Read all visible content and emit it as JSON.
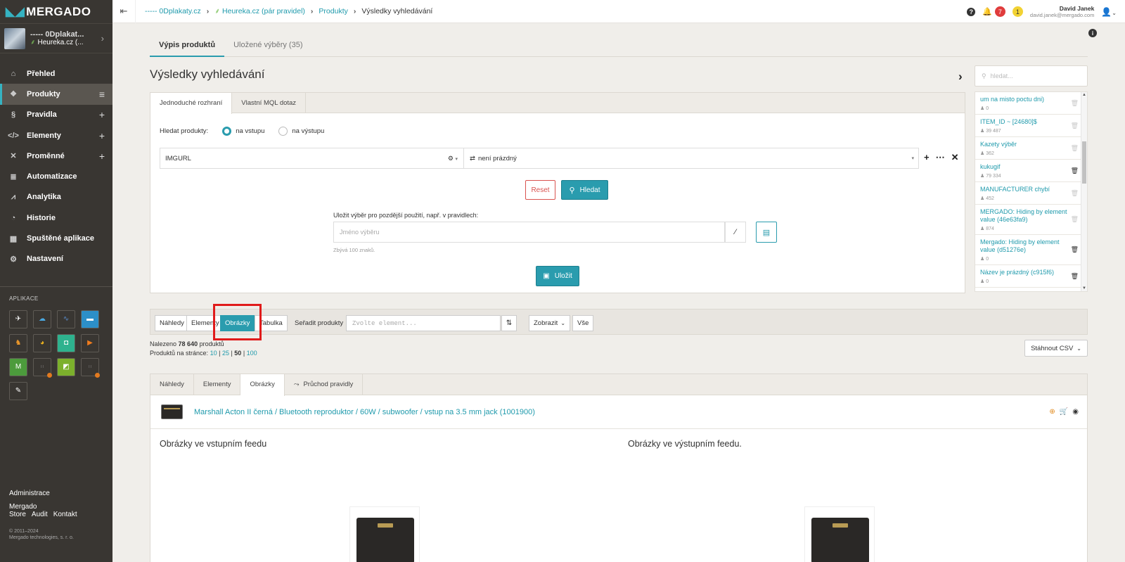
{
  "app": {
    "logo": "MERGADO"
  },
  "shop": {
    "name": "----- 0Dplakat...",
    "channel": "Heureka.cz (..."
  },
  "nav": [
    {
      "label": "Přehled",
      "icon": "home-icon",
      "glyph": "⌂",
      "plus": ""
    },
    {
      "label": "Produkty",
      "icon": "products-icon",
      "glyph": "❖",
      "plus": "≡"
    },
    {
      "label": "Pravidla",
      "icon": "rules-icon",
      "glyph": "§",
      "plus": "+"
    },
    {
      "label": "Elementy",
      "icon": "code-icon",
      "glyph": "</>",
      "plus": "+"
    },
    {
      "label": "Proměnné",
      "icon": "variables-icon",
      "glyph": "✕",
      "plus": "+"
    },
    {
      "label": "Automatizace",
      "icon": "automation-icon",
      "glyph": "≣",
      "plus": ""
    },
    {
      "label": "Analytika",
      "icon": "analytics-icon",
      "glyph": "⩘",
      "plus": ""
    },
    {
      "label": "Historie",
      "icon": "history-icon",
      "glyph": "◔",
      "plus": ""
    },
    {
      "label": "Spuštěné aplikace",
      "icon": "apps-grid-icon",
      "glyph": "▦",
      "plus": ""
    },
    {
      "label": "Nastavení",
      "icon": "gear-icon",
      "glyph": "⚙",
      "plus": ""
    }
  ],
  "apps_label": "APLIKACE",
  "footer": {
    "admin": "Administrace",
    "links": [
      "Mergado Store",
      "Audit",
      "Kontakt"
    ],
    "copy1": "© 2011–2024",
    "copy2": "Mergado technologies, s. r. o."
  },
  "breadcrumbs": [
    "----- 0Dplakaty.cz",
    "Heureka.cz (pár pravidel)",
    "Produkty"
  ],
  "breadcrumb_current": "Výsledky vyhledávání",
  "top": {
    "notif_red": "7",
    "notif_yellow": "1",
    "user_name": "David Janek",
    "user_email": "david.janek@mergado.com"
  },
  "main_tabs": [
    "Výpis produktů",
    "Uložené výběry (35)"
  ],
  "page_title": "Výsledky vyhledávání",
  "search": {
    "tabs": [
      "Jednoduché rozhraní",
      "Vlastní MQL dotaz"
    ],
    "find_label": "Hledat produkty:",
    "radio_in": "na vstupu",
    "radio_out": "na výstupu",
    "element": "IMGURL",
    "condition": "není prázdný",
    "reset": "Reset",
    "search_btn": "Hledat",
    "save_label": "Uložit výběr pro pozdější použití, např. v pravidlech:",
    "save_placeholder": "Jméno výběru",
    "remaining": "Zbývá 100 znaků.",
    "save_btn": "Uložit"
  },
  "saved": {
    "placeholder": "hledat...",
    "items": [
      {
        "name": "um na misto poctu dni)",
        "count": "0",
        "dark": false
      },
      {
        "name": "ITEM_ID ~ [24680]$",
        "count": "39 487",
        "dark": false
      },
      {
        "name": "Kazety výběr",
        "count": "362",
        "dark": false
      },
      {
        "name": "kukugif",
        "count": "79 334",
        "dark": true
      },
      {
        "name": "MANUFACTURER chybí",
        "count": "452",
        "dark": false
      },
      {
        "name": "MERGADO: Hiding by element value (46e63fa9)",
        "count": "874",
        "dark": false
      },
      {
        "name": "Mergado: Hiding by element value (d51276e)",
        "count": "0",
        "dark": true
      },
      {
        "name": "Název je prázdný (c915f6)",
        "count": "0",
        "dark": true
      }
    ]
  },
  "results": {
    "view_btns": [
      "Náhledy",
      "Elementy",
      "Obrázky",
      "Tabulka"
    ],
    "sort_label": "Seřadit produkty",
    "sort_placeholder": "Zvolte element...",
    "show": "Zobrazit",
    "all": "Vše",
    "found_prefix": "Nalezeno",
    "found_count": "78 640",
    "found_suffix": "produktů",
    "per_page_label": "Produktů na stránce:",
    "per_page": [
      "10",
      "25",
      "50",
      "100"
    ],
    "csv": "Stáhnout CSV"
  },
  "card": {
    "tabs": [
      "Náhledy",
      "Elementy",
      "Obrázky",
      "Průchod pravidly"
    ],
    "product": "Marshall Acton II černá / Bluetooth reproduktor / 60W / subwoofer / vstup na 3.5 mm jack (1001900)",
    "in_title": "Obrázky ve vstupním feedu",
    "out_title": "Obrázky ve výstupním feedu."
  },
  "colors": {
    "accent": "#2a9cae",
    "sidebar": "#393632",
    "highlight": "#e01b1b"
  }
}
